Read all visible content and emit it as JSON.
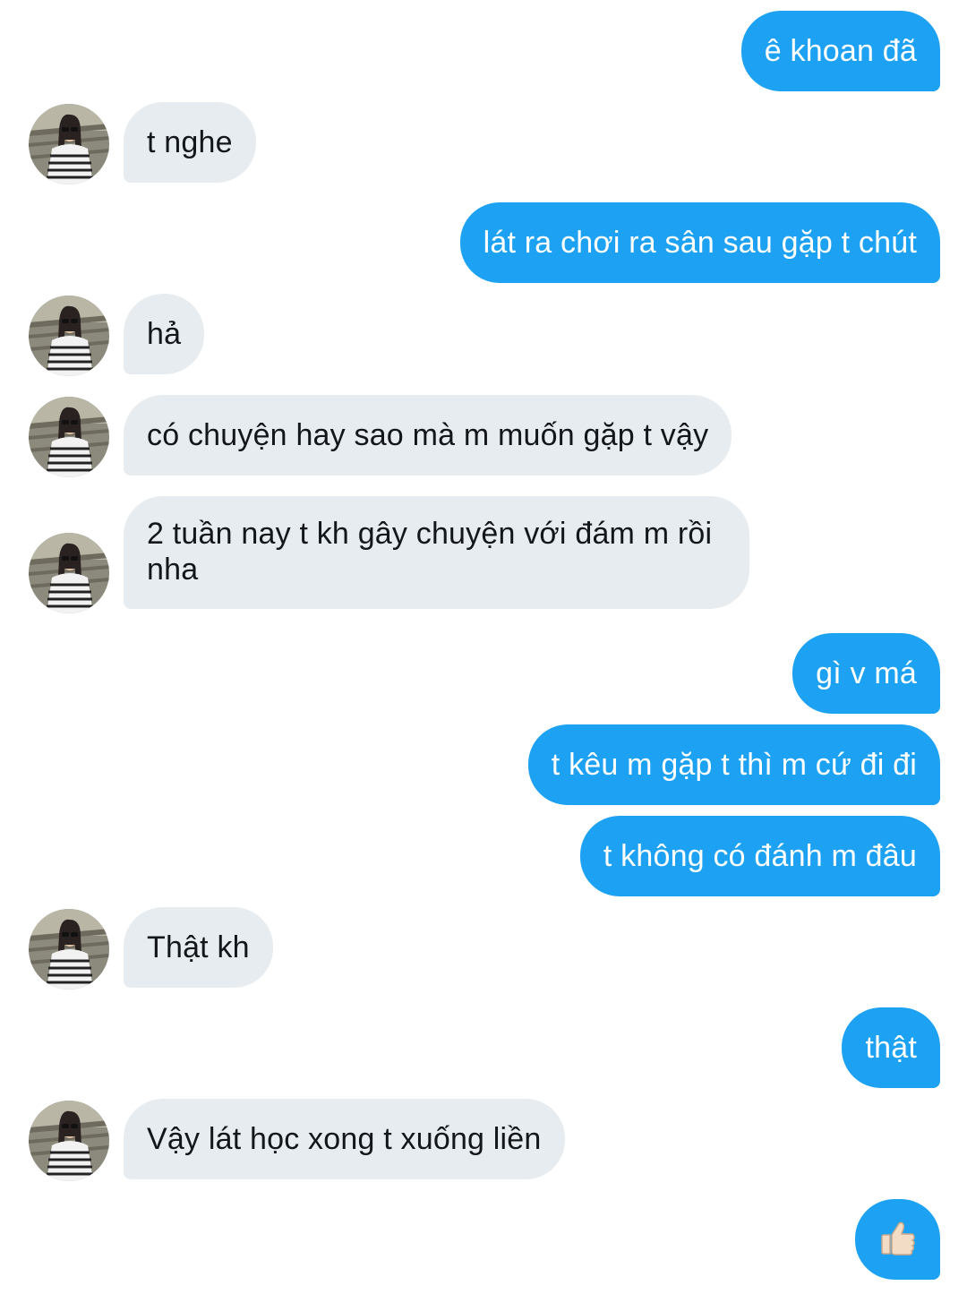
{
  "conversation": {
    "messages": [
      {
        "id": 0,
        "side": "out",
        "text": "ê khoan đã"
      },
      {
        "id": 1,
        "side": "in",
        "text": "t nghe"
      },
      {
        "id": 2,
        "side": "out",
        "text": "lát ra chơi ra sân sau gặp t chút"
      },
      {
        "id": 3,
        "side": "in",
        "text": "hả"
      },
      {
        "id": 4,
        "side": "in",
        "text": "có chuyện hay sao mà m muốn gặp t vậy"
      },
      {
        "id": 5,
        "side": "in",
        "text": "2 tuần nay t kh gây chuyện với đám m rồi nha"
      },
      {
        "id": 6,
        "side": "out",
        "text": "gì v má"
      },
      {
        "id": 7,
        "side": "out",
        "text": "t kêu m gặp t thì m cứ đi đi"
      },
      {
        "id": 8,
        "side": "out",
        "text": "t không có đánh m đâu"
      },
      {
        "id": 9,
        "side": "in",
        "text": "Thật kh"
      },
      {
        "id": 10,
        "side": "out",
        "text": "thật"
      },
      {
        "id": 11,
        "side": "in",
        "text": "Vậy lát học xong t xuống liền"
      },
      {
        "id": 12,
        "side": "out",
        "icon": "thumbs-up-icon"
      }
    ]
  },
  "colors": {
    "outgoing_bubble": "#1da1f2",
    "incoming_bubble": "#e7ecf0",
    "outgoing_text": "#ffffff",
    "incoming_text": "#14171a",
    "thumb_skin": "#f3dcc6"
  }
}
